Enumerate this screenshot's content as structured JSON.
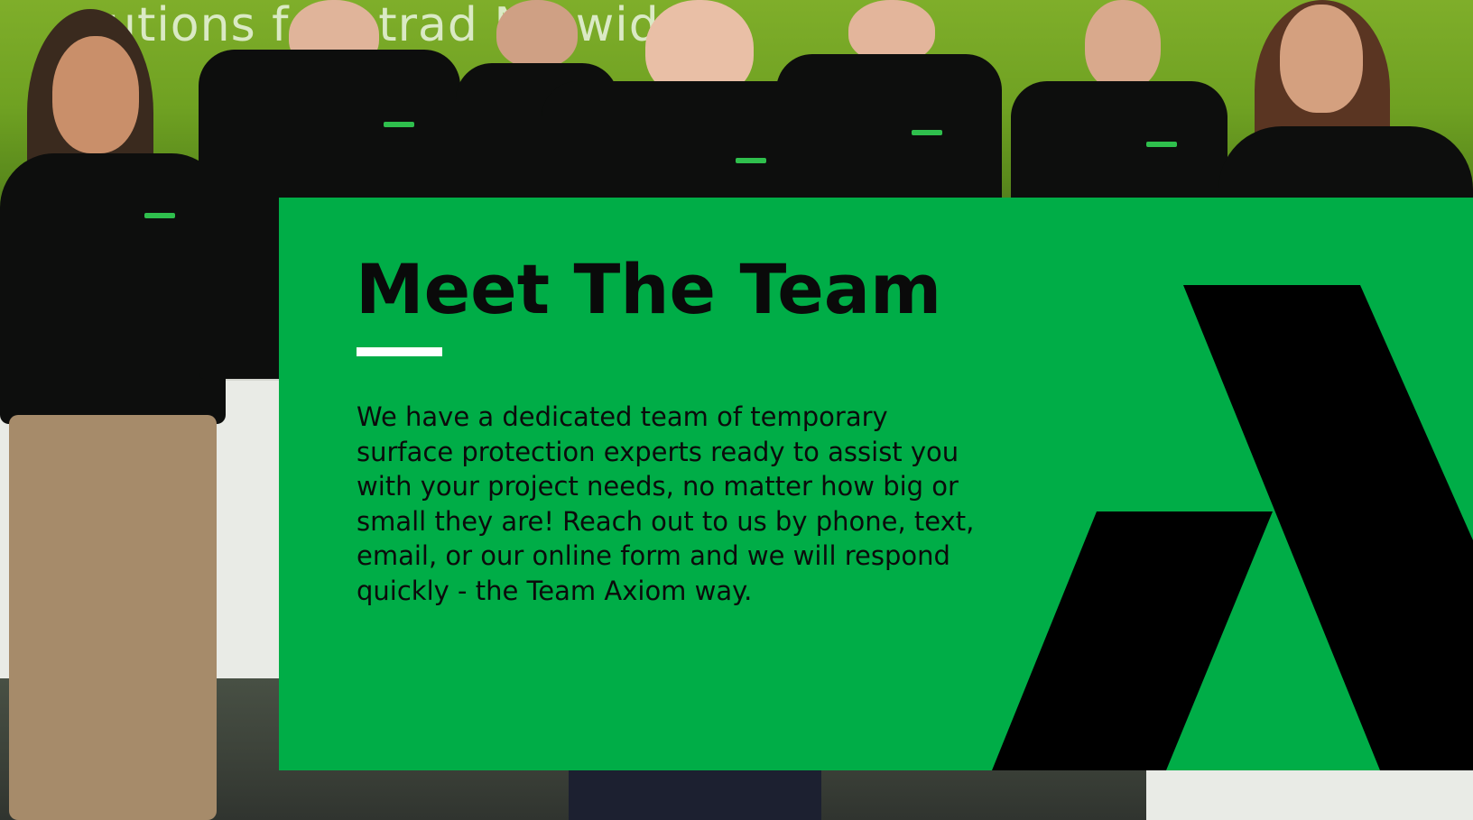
{
  "background": {
    "wall_text": "utions fo ll trad  Na  wide"
  },
  "section": {
    "title": "Meet The Team",
    "body": "We have a dedicated team of temporary surface protection experts ready to assist you with your project needs, no matter how big or small they are! Reach out to us by phone, text, email, or our online form and we will respond quickly - the Team Axiom way."
  },
  "colors": {
    "panel_green": "#00ad47",
    "title_black": "#0a0a0a",
    "underline_white": "#ffffff",
    "logo_black": "#000000"
  },
  "icons": {
    "brand_mark": "axiom-a-logo-icon"
  }
}
